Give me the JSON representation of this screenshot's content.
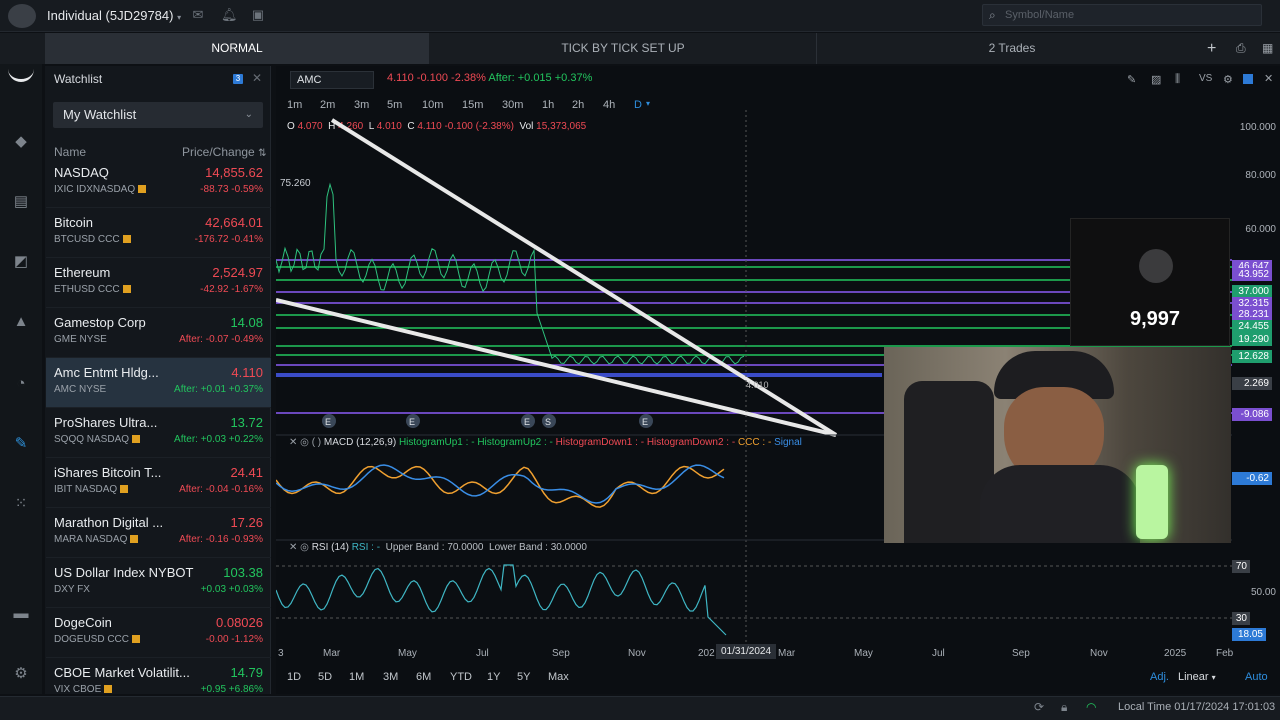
{
  "header": {
    "account": "Individual (5JD29784)",
    "search_placeholder": "Symbol/Name"
  },
  "tabs": [
    "NORMAL",
    "TICK BY TICK SET UP",
    "2 Trades"
  ],
  "watchlist": {
    "title": "Watchlist",
    "badge": "3",
    "selected_list": "My Watchlist",
    "col_name": "Name",
    "col_price": "Price/Change",
    "rows": [
      {
        "name": "NASDAQ",
        "sub": "IXIC IDXNASDAQ",
        "price": "14,855.62",
        "change": "-88.73 -0.59%",
        "price_dir": "down",
        "change_dir": "down"
      },
      {
        "name": "Bitcoin",
        "sub": "BTCUSD CCC",
        "price": "42,664.01",
        "change": "-176.72 -0.41%",
        "price_dir": "down",
        "change_dir": "down"
      },
      {
        "name": "Ethereum",
        "sub": "ETHUSD CCC",
        "price": "2,524.97",
        "change": "-42.92 -1.67%",
        "price_dir": "down",
        "change_dir": "down"
      },
      {
        "name": "Gamestop Corp",
        "sub": "GME NYSE",
        "price": "14.08",
        "change": "After: -0.07 -0.49%",
        "price_dir": "up",
        "change_dir": "down"
      },
      {
        "name": "Amc Entmt Hldg...",
        "sub": "AMC NYSE",
        "price": "4.110",
        "change": "After: +0.01 +0.37%",
        "price_dir": "down",
        "change_dir": "up"
      },
      {
        "name": "ProShares Ultra...",
        "sub": "SQQQ NASDAQ",
        "price": "13.72",
        "change": "After: +0.03 +0.22%",
        "price_dir": "up",
        "change_dir": "up"
      },
      {
        "name": "iShares Bitcoin T...",
        "sub": "IBIT NASDAQ",
        "price": "24.41",
        "change": "After: -0.04 -0.16%",
        "price_dir": "down",
        "change_dir": "down"
      },
      {
        "name": "Marathon Digital ...",
        "sub": "MARA NASDAQ",
        "price": "17.26",
        "change": "After: -0.16 -0.93%",
        "price_dir": "down",
        "change_dir": "down"
      },
      {
        "name": "US Dollar Index NYBOT",
        "sub": "DXY FX",
        "price": "103.38",
        "change": "+0.03 +0.03%",
        "price_dir": "up",
        "change_dir": "up"
      },
      {
        "name": "DogeCoin",
        "sub": "DOGEUSD CCC",
        "price": "0.08026",
        "change": "-0.00 -1.12%",
        "price_dir": "down",
        "change_dir": "down"
      },
      {
        "name": "CBOE Market Volatilit...",
        "sub": "VIX CBOE",
        "price": "14.79",
        "change": "+0.95 +6.86%",
        "price_dir": "up",
        "change_dir": "up"
      }
    ]
  },
  "chart": {
    "symbol": "AMC",
    "last": "4.110",
    "change": "-0.100",
    "change_pct": "-2.38%",
    "after_label": "After:",
    "after_change": "+0.015",
    "after_pct": "+0.37%",
    "timeframes": [
      "1m",
      "2m",
      "3m",
      "5m",
      "10m",
      "15m",
      "30m",
      "1h",
      "2h",
      "4h",
      "D"
    ],
    "ohlc": {
      "o": "4.070",
      "h": "4.260",
      "l": "4.010",
      "c": "4.110",
      "chg": "-0.100 (-2.38%)",
      "vol": "15,373,065"
    },
    "high_marker": "75.260",
    "y_labels": [
      "100.000",
      "80.000",
      "60.000"
    ],
    "price_tags": [
      {
        "v": "46.647",
        "color": "#7a4fd0"
      },
      {
        "v": "43.952",
        "color": "#7a4fd0"
      },
      {
        "v": "37.000",
        "color": "#1f9e6e"
      },
      {
        "v": "32.315",
        "color": "#7a4fd0"
      },
      {
        "v": "28.231",
        "color": "#7a4fd0"
      },
      {
        "v": "24.455",
        "color": "#1f9e6e"
      },
      {
        "v": "19.290",
        "color": "#1f9e6e"
      },
      {
        "v": "12.628",
        "color": "#1f9e6e"
      },
      {
        "v": "2.269",
        "color": "#3a3f46"
      },
      {
        "v": "-9.086",
        "color": "#7a4fd0"
      },
      {
        "v": "-0.62",
        "color": "#2d7ad6"
      }
    ],
    "macd": {
      "label": "MACD (12,26,9)",
      "hist_up1": "HistogramUp1 : -",
      "hist_up2": "HistogramUp2 : -",
      "hist_down1": "HistogramDown1 : -",
      "hist_down2": "HistogramDown2 : -",
      "ccc": "CCC : -",
      "signal": "Signal"
    },
    "rsi": {
      "label": "RSI (14)",
      "rsi_val": "RSI : -",
      "upper": "Upper Band : 70.0000",
      "lower": "Lower Band : 30.0000",
      "tag70": "70",
      "tag50": "50.00",
      "tag30": "30",
      "tag_val": "18.05"
    },
    "x_labels": [
      "Mar",
      "May",
      "Jul",
      "Sep",
      "Nov",
      "202",
      "Mar",
      "May",
      "Jul",
      "Sep",
      "Nov",
      "2025",
      "Feb"
    ],
    "x_first": "3",
    "crosshair_date": "01/31/2024",
    "crosshair_price": "4.010",
    "ranges": [
      "1D",
      "5D",
      "1M",
      "3M",
      "6M",
      "YTD",
      "1Y",
      "5Y",
      "Max"
    ],
    "scale_adj": "Adj.",
    "scale_type": "Linear",
    "scale_auto": "Auto"
  },
  "overlay": {
    "counter": "9,997"
  },
  "status": {
    "local_time": "Local Time 01/17/2024 17:01:03"
  }
}
